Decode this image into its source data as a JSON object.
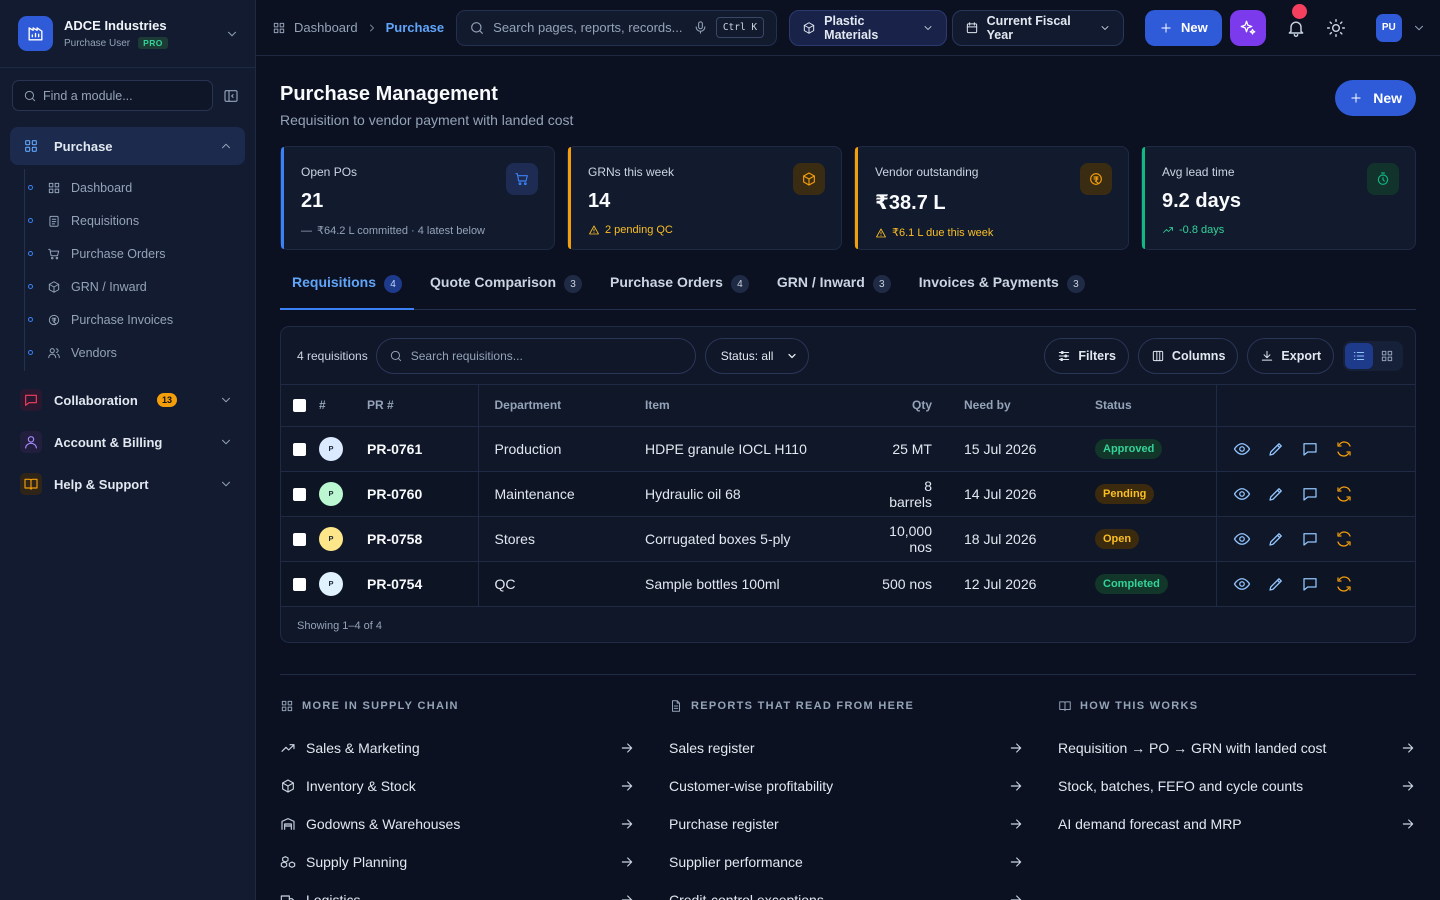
{
  "org": {
    "name": "ADCE Industries",
    "role": "Purchase User",
    "plan": "PRO"
  },
  "sidebar": {
    "find_placeholder": "Find a module...",
    "active_group": {
      "label": "Purchase",
      "items": [
        {
          "label": "Dashboard",
          "icon": "grid-icon"
        },
        {
          "label": "Requisitions",
          "icon": "clipboard-icon"
        },
        {
          "label": "Purchase Orders",
          "icon": "cart-icon"
        },
        {
          "label": "GRN / Inward",
          "icon": "box-icon"
        },
        {
          "label": "Purchase Invoices",
          "icon": "coin-icon"
        },
        {
          "label": "Vendors",
          "icon": "users-icon"
        }
      ]
    },
    "groups": [
      {
        "label": "Collaboration",
        "badge": "13",
        "color": "#f43f5e"
      },
      {
        "label": "Account & Billing",
        "color": "#8b5cf6"
      },
      {
        "label": "Help & Support",
        "color": "#f59e0b"
      }
    ]
  },
  "topbar": {
    "breadcrumb": [
      "Dashboard",
      "Purchase"
    ],
    "search_placeholder": "Search pages, reports, records...",
    "shortcut": "Ctrl K",
    "division": "Plastic Materials",
    "period": "Current Fiscal Year",
    "new_label": "New",
    "user_initials": "PU"
  },
  "page": {
    "title": "Purchase Management",
    "subtitle": "Requisition to vendor payment with landed cost",
    "new_label": "New"
  },
  "kpis": [
    {
      "label": "Open POs",
      "value": "21",
      "foot": "₹64.2 L committed · 4 latest below",
      "accent": "#3b82f6",
      "icon": "cart-icon"
    },
    {
      "label": "GRNs this week",
      "value": "14",
      "foot": "2 pending QC",
      "accent": "#f59e0b",
      "icon": "box-icon"
    },
    {
      "label": "Vendor outstanding",
      "value": "₹38.7 L",
      "foot": "₹6.1 L due this week",
      "accent": "#f59e0b",
      "icon": "coin-icon"
    },
    {
      "label": "Avg lead time",
      "value": "9.2 days",
      "foot": "-0.8 days",
      "accent": "#10b981",
      "icon": "timer-icon"
    }
  ],
  "tabs": [
    {
      "label": "Requisitions",
      "count": "4",
      "active": true
    },
    {
      "label": "Quote Comparison",
      "count": "3"
    },
    {
      "label": "Purchase Orders",
      "count": "4"
    },
    {
      "label": "GRN / Inward",
      "count": "3"
    },
    {
      "label": "Invoices & Payments",
      "count": "3"
    }
  ],
  "table": {
    "record_count": "4 requisitions",
    "search_placeholder": "Search requisitions...",
    "status_filter": "Status: all",
    "filters_label": "Filters",
    "columns_label": "Columns",
    "export_label": "Export",
    "headers": [
      "#",
      "PR #",
      "Department",
      "Item",
      "Qty",
      "Need by",
      "Status"
    ],
    "rows": [
      {
        "avatar": "P",
        "avatar_color": "#dbeafe",
        "pr": "PR-0761",
        "dept": "Production",
        "item": "HDPE granule IOCL H110",
        "qty": "25 MT",
        "need_by": "15 Jul 2026",
        "status": "Approved",
        "status_bg": "#123629",
        "status_fg": "#34d399"
      },
      {
        "avatar": "P",
        "avatar_color": "#bbf7d0",
        "pr": "PR-0760",
        "dept": "Maintenance",
        "item": "Hydraulic oil 68",
        "qty": "8 barrels",
        "need_by": "14 Jul 2026",
        "status": "Pending",
        "status_bg": "#3b2a0d",
        "status_fg": "#fbbf24"
      },
      {
        "avatar": "P",
        "avatar_color": "#fde68a",
        "pr": "PR-0758",
        "dept": "Stores",
        "item": "Corrugated boxes 5-ply",
        "qty": "10,000 nos",
        "need_by": "18 Jul 2026",
        "status": "Open",
        "status_bg": "#3b2a0d",
        "status_fg": "#fbbf24"
      },
      {
        "avatar": "P",
        "avatar_color": "#e0f2fe",
        "pr": "PR-0754",
        "dept": "QC",
        "item": "Sample bottles 100ml",
        "qty": "500 nos",
        "need_by": "12 Jul 2026",
        "status": "Completed",
        "status_bg": "#123629",
        "status_fg": "#34d399"
      }
    ],
    "footer": "Showing 1–4 of 4"
  },
  "more": [
    {
      "heading": "MORE IN SUPPLY CHAIN",
      "icon": "grid-icon",
      "items": [
        {
          "label": "Sales & Marketing",
          "icon": "trend-icon"
        },
        {
          "label": "Inventory & Stock",
          "icon": "box-icon"
        },
        {
          "label": "Godowns & Warehouses",
          "icon": "warehouse-icon"
        },
        {
          "label": "Supply Planning",
          "icon": "boxes-icon"
        },
        {
          "label": "Logistics",
          "icon": "truck-icon"
        }
      ]
    },
    {
      "heading": "REPORTS THAT READ FROM HERE",
      "icon": "file-icon",
      "items": [
        {
          "label": "Sales register"
        },
        {
          "label": "Customer-wise profitability"
        },
        {
          "label": "Purchase register"
        },
        {
          "label": "Supplier performance"
        },
        {
          "label": "Credit-control exceptions"
        }
      ]
    },
    {
      "heading": "HOW THIS WORKS",
      "icon": "book-icon",
      "items": [
        {
          "label": "Requisition → PO → GRN with landed cost"
        },
        {
          "label": "Stock, batches, FEFO and cycle counts"
        },
        {
          "label": "AI demand forecast and MRP"
        }
      ]
    }
  ]
}
